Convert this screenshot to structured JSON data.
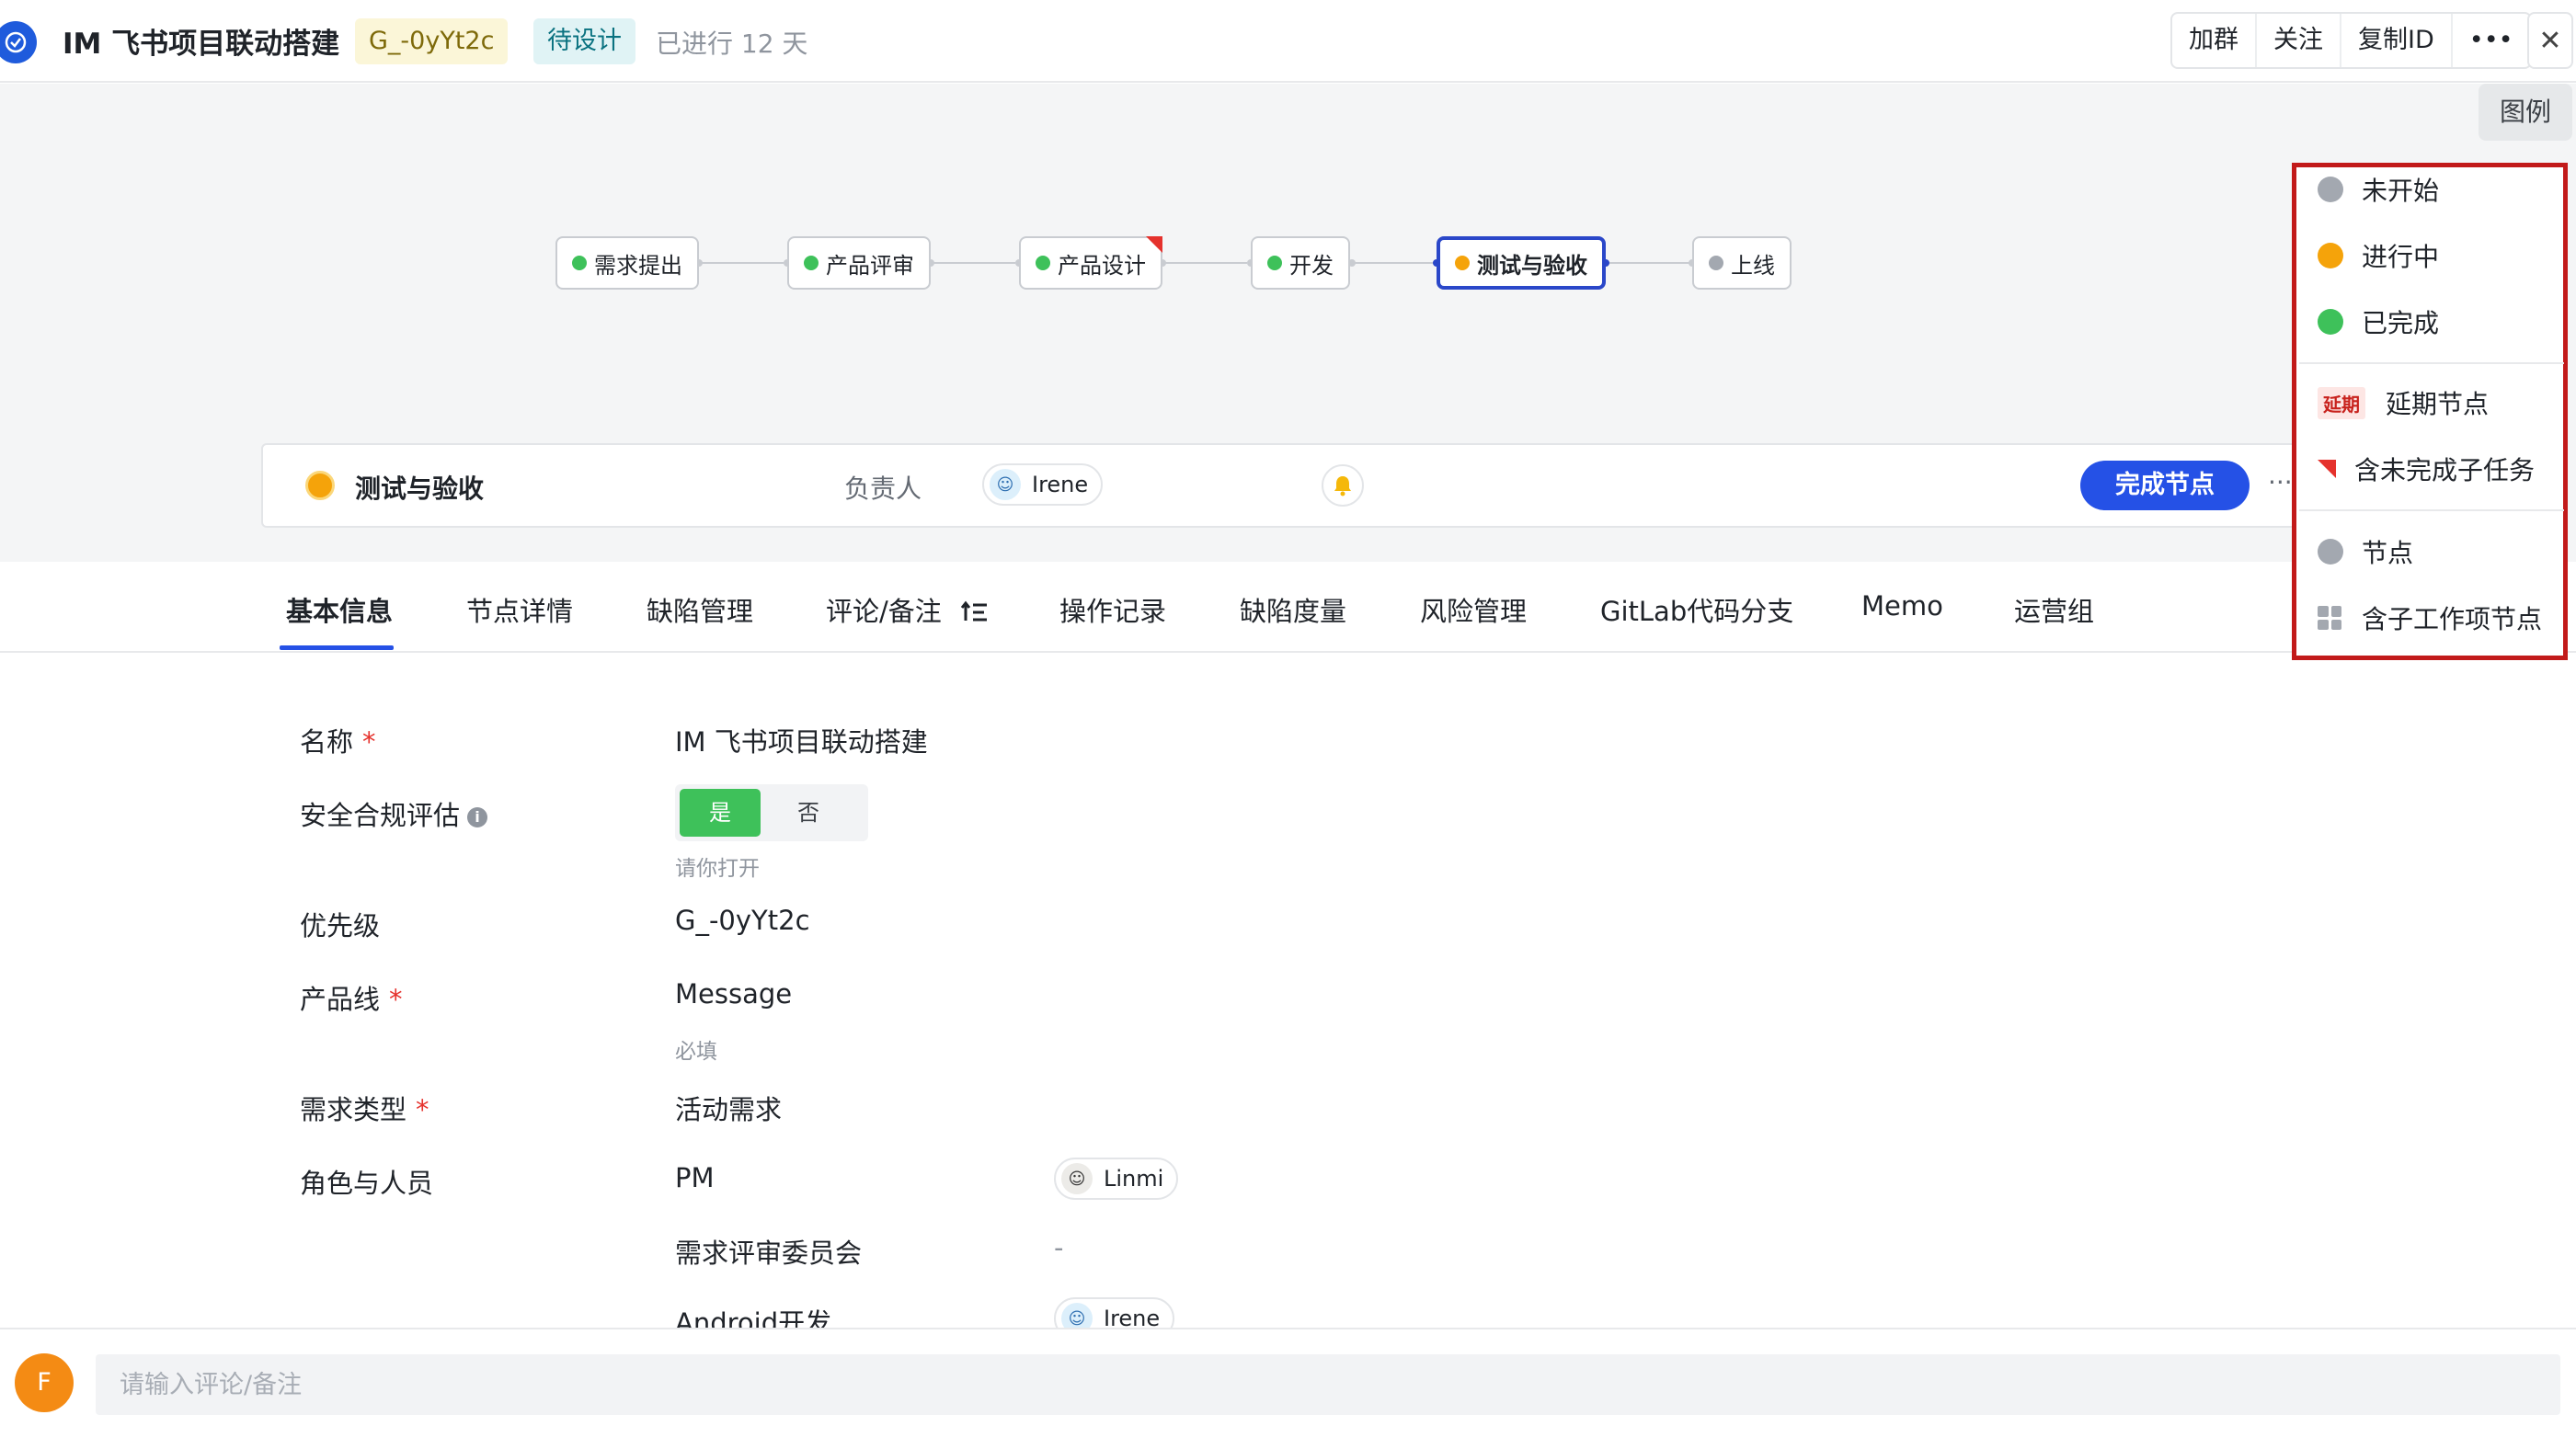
{
  "header": {
    "title": "IM 飞书项目联动搭建",
    "id_tag": "G_-0yYt2c",
    "status_tag": "待设计",
    "days": "已进行 12 天",
    "actions": [
      "加群",
      "关注",
      "复制ID",
      "•••"
    ],
    "close": "✕"
  },
  "colors": {
    "not_started": "#a3a8b0",
    "in_progress": "#f5a30a",
    "completed": "#3ec15a",
    "accent": "#2551e6",
    "legend_border": "#c21a1a"
  },
  "flow": {
    "legend_button": "图例",
    "nodes": [
      {
        "label": "需求提出",
        "status": "completed"
      },
      {
        "label": "产品评审",
        "status": "completed"
      },
      {
        "label": "产品设计",
        "status": "completed",
        "has_unfinished_subtask": true
      },
      {
        "label": "开发",
        "status": "completed"
      },
      {
        "label": "测试与验收",
        "status": "in_progress",
        "selected": true
      },
      {
        "label": "上线",
        "status": "not_started"
      }
    ]
  },
  "node_bar": {
    "name": "测试与验收",
    "owner_label": "负责人",
    "owner": "Irene",
    "complete_button": "完成节点",
    "more": "···"
  },
  "tabs": [
    "基本信息",
    "节点详情",
    "缺陷管理",
    "评论/备注",
    "操作记录",
    "缺陷度量",
    "风险管理",
    "GitLab代码分支",
    "Memo",
    "运营组"
  ],
  "active_tab": "基本信息",
  "form": {
    "name_label": "名称",
    "name_value": "IM 飞书项目联动搭建",
    "security_label": "安全合规评估",
    "security_yes": "是",
    "security_no": "否",
    "security_hint": "请你打开",
    "priority_label": "优先级",
    "priority_value": "G_-0yYt2c",
    "product_line_label": "产品线",
    "product_line_value": "Message",
    "product_line_hint": "必填",
    "req_type_label": "需求类型",
    "req_type_value": "活动需求",
    "roles_label": "角色与人员",
    "roles": [
      {
        "role": "PM",
        "person": "Linmi"
      },
      {
        "role": "需求评审委员会",
        "person": "-"
      },
      {
        "role": "Android开发",
        "person": "Irene"
      }
    ],
    "required_mark": "*"
  },
  "comment": {
    "avatar_letter": "F",
    "placeholder": "请输入评论/备注"
  },
  "legend": {
    "not_started": "未开始",
    "in_progress": "进行中",
    "completed": "已完成",
    "delay_badge": "延期",
    "delay_label": "延期节点",
    "unfinished_subtask": "含未完成子任务",
    "node": "节点",
    "sub_work_item_node": "含子工作项节点"
  }
}
